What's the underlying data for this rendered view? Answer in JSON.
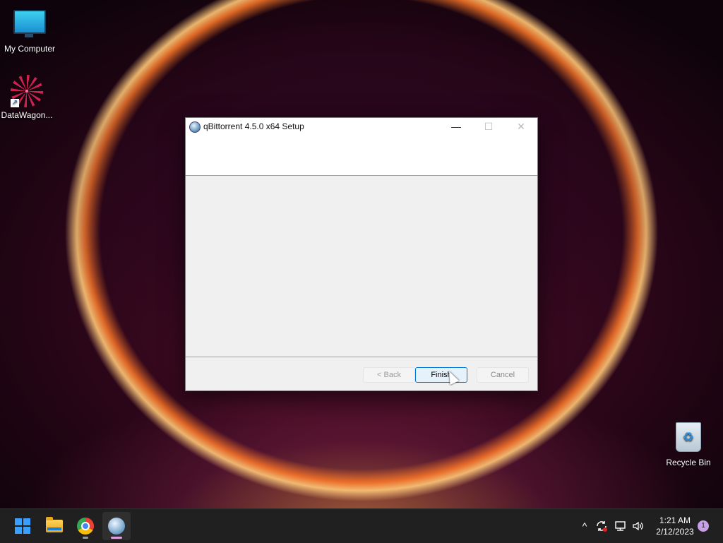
{
  "desktop": {
    "icons": [
      {
        "label": "My Computer"
      },
      {
        "label": "DataWagon..."
      },
      {
        "label": "Recycle Bin"
      }
    ]
  },
  "dialog": {
    "title": "qBittorrent 4.5.0 x64 Setup",
    "buttons": {
      "back": "< Back",
      "finish": "Finish",
      "cancel": "Cancel"
    },
    "controls": {
      "minimize": "—",
      "maximize": "☐",
      "close": "✕"
    }
  },
  "taskbar": {
    "tray": {
      "chevron": "^",
      "volume": "🔊"
    },
    "clock": {
      "time": "1:21 AM",
      "date": "2/12/2023"
    },
    "notification_count": "1"
  }
}
